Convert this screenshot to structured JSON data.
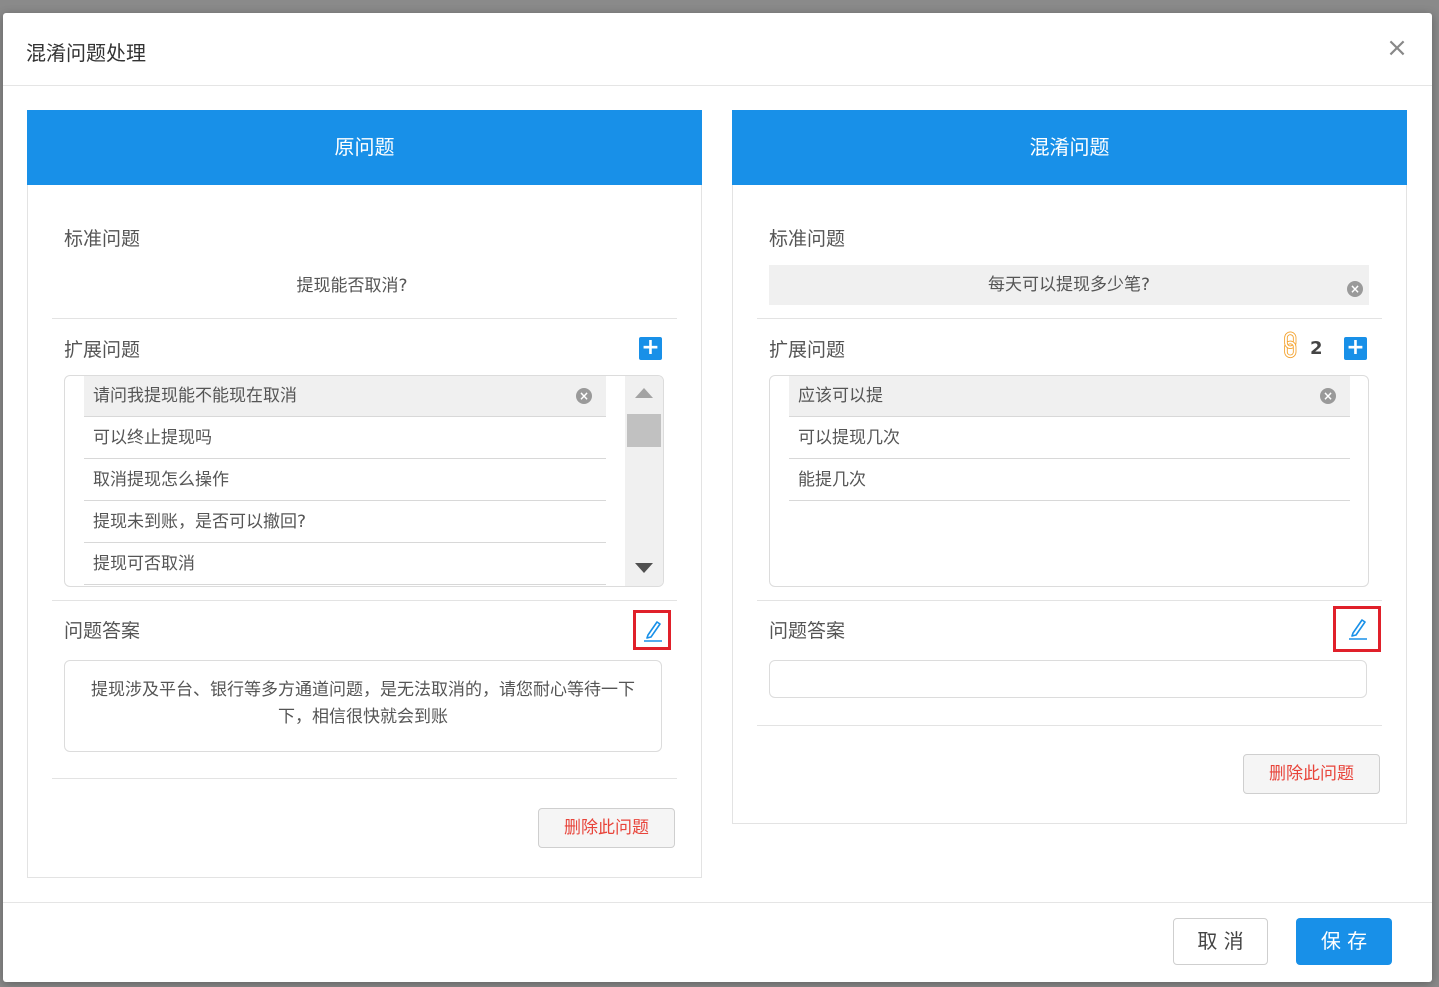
{
  "dialog": {
    "title": "混淆问题处理",
    "close_icon": "×"
  },
  "left": {
    "header": "原问题",
    "std_label": "标准问题",
    "std_value": "提现能否取消?",
    "ext_label": "扩展问题",
    "ext_items": [
      "请问我提现能不能现在取消",
      "可以终止提现吗",
      "取消提现怎么操作",
      "提现未到账，是否可以撤回?",
      "提现可否取消"
    ],
    "answer_label": "问题答案",
    "answer_text": "提现涉及平台、银行等多方通道问题，是无法取消的，请您耐心等待一下下，相信很快就会到账",
    "delete_label": "删除此问题"
  },
  "right": {
    "header": "混淆问题",
    "std_label": "标准问题",
    "std_value": "每天可以提现多少笔?",
    "ext_label": "扩展问题",
    "link_count": "2",
    "ext_items": [
      "应该可以提",
      "可以提现几次",
      "能提几次"
    ],
    "answer_label": "问题答案",
    "answer_text": "",
    "delete_label": "删除此问题"
  },
  "footer": {
    "cancel_label": "取 消",
    "save_label": "保 存"
  },
  "colors": {
    "primary": "#1890e8",
    "danger": "#e8443a",
    "highlight": "#e0202a",
    "link": "#f4a22d"
  },
  "icons": [
    "close-icon",
    "clear-icon",
    "add-icon",
    "link-icon",
    "edit-icon",
    "scroll-up-icon",
    "scroll-down-icon"
  ]
}
